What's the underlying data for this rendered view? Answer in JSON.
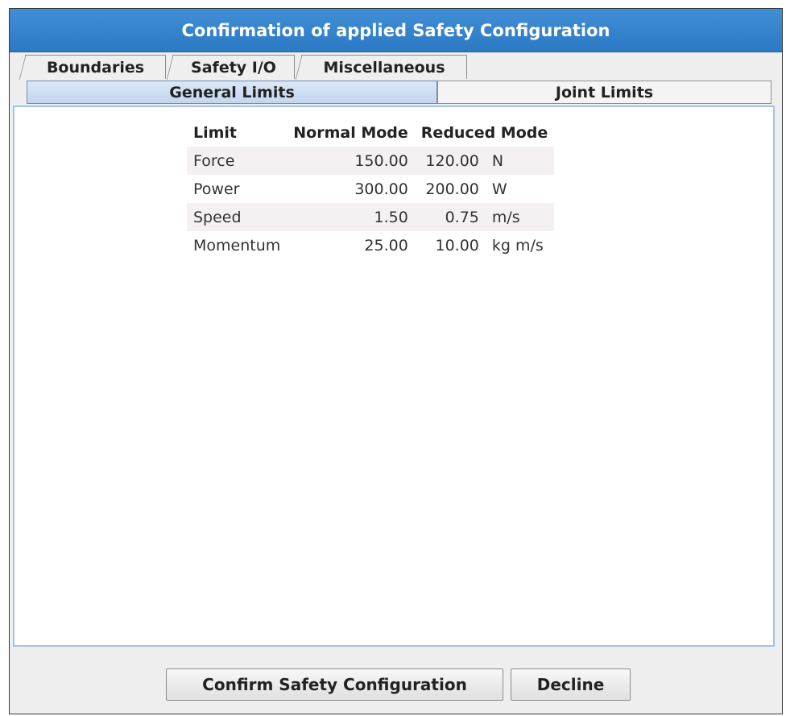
{
  "dialog": {
    "title": "Confirmation of applied Safety Configuration"
  },
  "tabs": {
    "row1": [
      {
        "label": "Boundaries"
      },
      {
        "label": "Safety I/O"
      },
      {
        "label": "Miscellaneous"
      }
    ],
    "row2": [
      {
        "label": "General Limits",
        "selected": true
      },
      {
        "label": "Joint Limits",
        "selected": false
      }
    ]
  },
  "limits_table": {
    "headers": [
      "Limit",
      "Normal Mode",
      "Reduced Mode"
    ],
    "rows": [
      {
        "limit": "Force",
        "normal": "150.00",
        "reduced": "120.00",
        "unit": "N"
      },
      {
        "limit": "Power",
        "normal": "300.00",
        "reduced": "200.00",
        "unit": "W"
      },
      {
        "limit": "Speed",
        "normal": "1.50",
        "reduced": "0.75",
        "unit": "m/s"
      },
      {
        "limit": "Momentum",
        "normal": "25.00",
        "reduced": "10.00",
        "unit": "kg m/s"
      }
    ]
  },
  "buttons": {
    "confirm": "Confirm Safety Configuration",
    "decline": "Decline"
  }
}
